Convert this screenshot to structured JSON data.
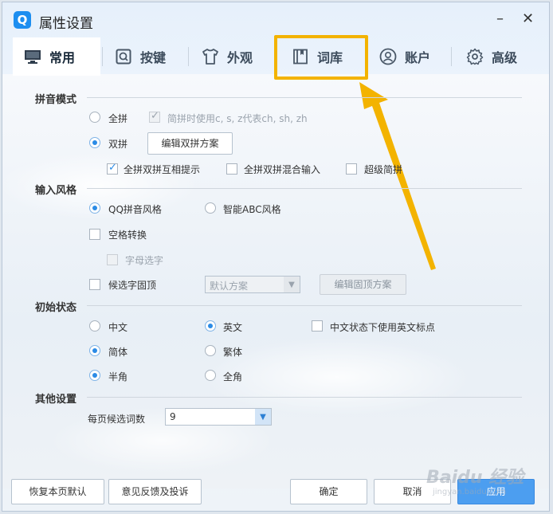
{
  "window": {
    "title": "属性设置",
    "logo_letter": "Q",
    "minimize": "–",
    "close": "✕"
  },
  "tabs": [
    {
      "label": "常用",
      "icon": "monitor-icon"
    },
    {
      "label": "按键",
      "icon": "keyboard-key-icon"
    },
    {
      "label": "外观",
      "icon": "tshirt-icon"
    },
    {
      "label": "词库",
      "icon": "book-icon"
    },
    {
      "label": "账户",
      "icon": "user-icon"
    },
    {
      "label": "高级",
      "icon": "gear-icon"
    }
  ],
  "pinyin_mode": {
    "title": "拼音模式",
    "full": "全拼",
    "full_option": "简拼时使用c, s, z代表ch, sh, zh",
    "double": "双拼",
    "edit_double_button": "编辑双拼方案",
    "opt_mutual_hint": "全拼双拼互相提示",
    "opt_mixed_input": "全拼双拼混合输入",
    "opt_super_short": "超级简拼"
  },
  "input_style": {
    "title": "输入风格",
    "qq_style": "QQ拼音风格",
    "abc_style": "智能ABC风格",
    "space_convert": "空格转换",
    "letter_select": "字母选字",
    "fixed_top": "候选字固顶",
    "scheme_select": "默认方案",
    "edit_fixed_button": "编辑固顶方案"
  },
  "initial_state": {
    "title": "初始状态",
    "chinese": "中文",
    "english": "英文",
    "english_punct": "中文状态下使用英文标点",
    "simplified": "简体",
    "traditional": "繁体",
    "half_width": "半角",
    "full_width": "全角"
  },
  "other": {
    "title": "其他设置",
    "per_page_label": "每页候选词数",
    "per_page_value": "9"
  },
  "footer": {
    "restore_button": "恢复本页默认",
    "feedback_button": "意见反馈及投诉",
    "ok_button": "确定",
    "cancel_button": "取消",
    "apply_button": "应用"
  },
  "watermark": {
    "brand": "Baidu 经验",
    "url": "jingyan.baidu.com"
  },
  "colors": {
    "accent": "#2b8be6",
    "highlight": "#f3b300",
    "primary_button": "#4c9ef0"
  }
}
